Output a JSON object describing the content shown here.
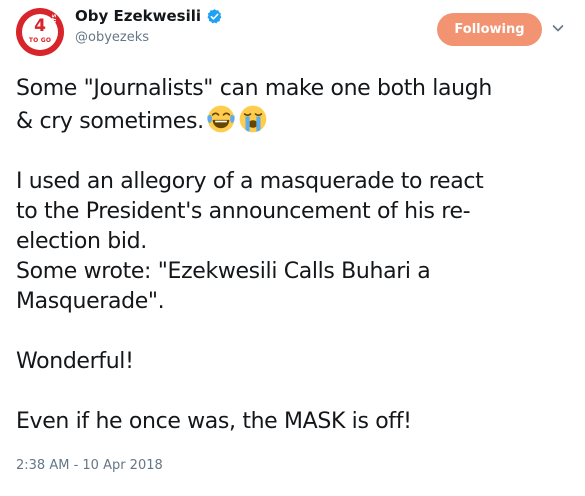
{
  "tweet": {
    "author": {
      "display_name": "Oby Ezekwesili",
      "handle": "@obyezeks",
      "verified": true,
      "avatar": {
        "number": "4",
        "side_text": "DAYS",
        "bottom_text": "TO GO",
        "color": "#d8242b"
      }
    },
    "follow_button_label": "Following",
    "text_line_1": "Some \"Journalists\" can make one both laugh",
    "text_line_2": "& cry sometimes.",
    "emojis": [
      "laughing-with-tears-emoji",
      "crying-emoji"
    ],
    "paragraph_2": "I used an allegory of a masquerade to react\nto the President's announcement of his re-\nelection bid.\nSome wrote: \"Ezekwesili Calls Buhari a\nMasquerade\".",
    "paragraph_3": "Wonderful!",
    "paragraph_4": "Even if he once was, the MASK is off!",
    "timestamp": "2:38 AM - 10 Apr 2018"
  },
  "colors": {
    "follow_button": "#f29371",
    "verified": "#1da1f2",
    "secondary_text": "#657786"
  }
}
